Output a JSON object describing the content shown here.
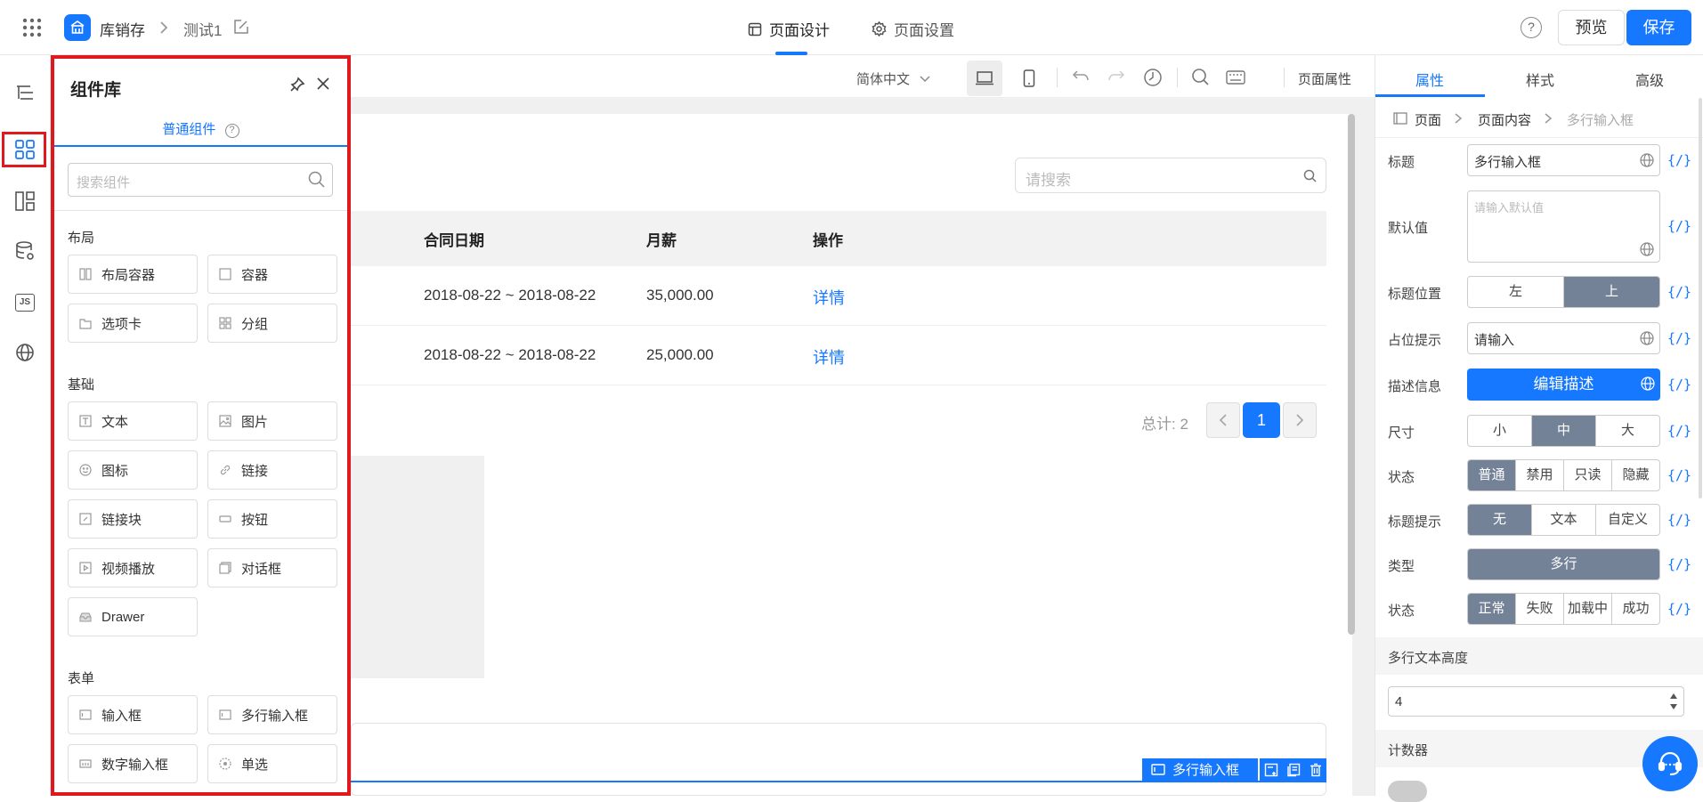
{
  "header": {
    "app_name": "库销存",
    "doc_name": "测试1",
    "tabs": [
      {
        "label": "页面设计",
        "active": true
      },
      {
        "label": "页面设置",
        "active": false
      }
    ],
    "help": "?",
    "preview_label": "预览",
    "save_label": "保存"
  },
  "left_rail": {
    "items": [
      "outline-icon",
      "components-icon",
      "layout-icon",
      "datasource-icon",
      "js-icon",
      "globe-icon"
    ],
    "js_label": "JS"
  },
  "component_panel": {
    "title": "组件库",
    "tab": "普通组件",
    "search_placeholder": "搜索组件",
    "groups": [
      {
        "name": "布局",
        "items": [
          {
            "label": "布局容器",
            "icon": "layout-container-icon"
          },
          {
            "label": "容器",
            "icon": "container-icon"
          },
          {
            "label": "选项卡",
            "icon": "tabs-icon"
          },
          {
            "label": "分组",
            "icon": "group-icon"
          }
        ]
      },
      {
        "name": "基础",
        "items": [
          {
            "label": "文本",
            "icon": "text-icon"
          },
          {
            "label": "图片",
            "icon": "image-icon"
          },
          {
            "label": "图标",
            "icon": "smile-icon"
          },
          {
            "label": "链接",
            "icon": "link-icon"
          },
          {
            "label": "链接块",
            "icon": "link-block-icon"
          },
          {
            "label": "按钮",
            "icon": "button-icon"
          },
          {
            "label": "视频播放",
            "icon": "video-icon"
          },
          {
            "label": "对话框",
            "icon": "dialog-icon"
          },
          {
            "label": "Drawer",
            "icon": "drawer-icon"
          }
        ]
      },
      {
        "name": "表单",
        "items": [
          {
            "label": "输入框",
            "icon": "input-icon"
          },
          {
            "label": "多行输入框",
            "icon": "textarea-icon"
          },
          {
            "label": "数字输入框",
            "icon": "number-input-icon"
          },
          {
            "label": "单选",
            "icon": "radio-icon"
          }
        ]
      }
    ]
  },
  "canvas_toolbar": {
    "language": "简体中文",
    "page_props": "页面属性"
  },
  "canvas": {
    "search_placeholder": "请搜索",
    "table": {
      "columns": [
        "合同日期",
        "月薪",
        "操作"
      ],
      "rows": [
        {
          "date": "2018-08-22 ~ 2018-08-22",
          "salary": "35,000.00",
          "action": "详情"
        },
        {
          "date": "2018-08-22 ~ 2018-08-22",
          "salary": "25,000.00",
          "action": "详情"
        }
      ]
    },
    "pagination": {
      "total": "总计: 2",
      "current": "1"
    },
    "selected_component": "多行输入框"
  },
  "right_panel": {
    "tabs": [
      {
        "label": "属性",
        "active": true
      },
      {
        "label": "样式",
        "active": false
      },
      {
        "label": "高级",
        "active": false
      }
    ],
    "breadcrumb": [
      "页面",
      "页面内容",
      "多行输入框"
    ],
    "var_label": "{/}",
    "props": {
      "title_label": "标题",
      "title_value": "多行输入框",
      "default_label": "默认值",
      "default_placeholder": "请输入默认值",
      "title_pos_label": "标题位置",
      "title_pos_options": [
        "左",
        "上"
      ],
      "title_pos_selected": "上",
      "placeholder_label": "占位提示",
      "placeholder_value": "请输入",
      "desc_label": "描述信息",
      "desc_button": "编辑描述",
      "size_label": "尺寸",
      "size_options": [
        "小",
        "中",
        "大"
      ],
      "size_selected": "中",
      "state_label": "状态",
      "state_options": [
        "普通",
        "禁用",
        "只读",
        "隐藏"
      ],
      "state_selected": "普通",
      "tooltip_label": "标题提示",
      "tooltip_options": [
        "无",
        "文本",
        "自定义"
      ],
      "tooltip_selected": "无",
      "type_label": "类型",
      "type_value": "多行",
      "status_label": "状态",
      "status_options": [
        "正常",
        "失败",
        "加载中",
        "成功"
      ],
      "status_selected": "正常"
    },
    "sections": {
      "rows_title": "多行文本高度",
      "rows_value": "4",
      "counter_title": "计数器"
    }
  },
  "colors": {
    "accent": "#1677ff",
    "highlight_red": "#e0191f",
    "segment_on": "#748297"
  }
}
